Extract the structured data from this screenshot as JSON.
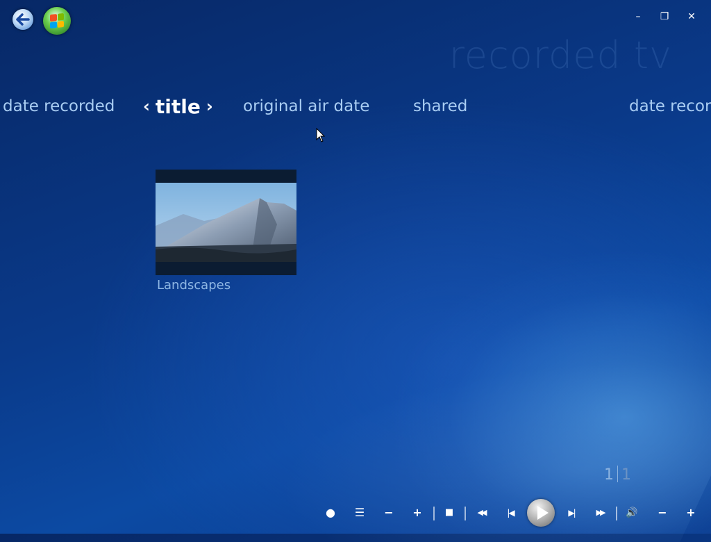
{
  "header": {
    "page_title": "recorded tv"
  },
  "sort_bar": {
    "items": [
      {
        "label": "date recorded"
      },
      {
        "label": "title"
      },
      {
        "label": "original air date"
      },
      {
        "label": "shared"
      },
      {
        "label": "date recor"
      }
    ],
    "left_arrow": "‹",
    "right_arrow": "›"
  },
  "library": {
    "items": [
      {
        "label": "Landscapes"
      }
    ]
  },
  "pager": {
    "current": "1",
    "total": "1"
  },
  "window_controls": {
    "minimize": "–",
    "restore": "❐",
    "close": "✕"
  },
  "transport": {
    "record": "●",
    "guide": "☰",
    "channel_down": "−",
    "channel_up": "+",
    "stop": "■",
    "rewind": "◀◀",
    "prev": "|◀",
    "next": "▶|",
    "fast_forward": "▶▶",
    "mute": "🔊",
    "volume_down": "−",
    "volume_up": "+"
  },
  "colors": {
    "background": "#0a3a8a",
    "text": "#a9cdf3",
    "active_text": "#ffffff"
  }
}
